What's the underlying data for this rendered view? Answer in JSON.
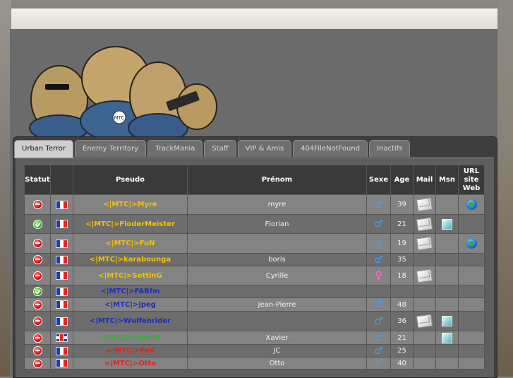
{
  "tabs": [
    {
      "label": "Urban Terror",
      "active": true
    },
    {
      "label": "Enemy Territory",
      "active": false
    },
    {
      "label": "TrackMania",
      "active": false
    },
    {
      "label": "Staff",
      "active": false
    },
    {
      "label": "VIP & Amis",
      "active": false
    },
    {
      "label": "404FileNotFound",
      "active": false
    },
    {
      "label": "Inactifs",
      "active": false
    }
  ],
  "table": {
    "headers": {
      "statut": "Statut",
      "pseudo": "Pseudo",
      "prenom": "Prénom",
      "sexe": "Sexe",
      "age": "Age",
      "mail": "Mail",
      "msn": "Msn",
      "url": "URL site Web"
    },
    "rows": [
      {
        "status": "offline",
        "flag": "fr",
        "pseudo": "<|MTC|>Myre",
        "color": "yellow",
        "prenom": "myre",
        "sexe": "male",
        "age": "39",
        "mail": true,
        "msn": false,
        "web": true
      },
      {
        "status": "online",
        "flag": "fr",
        "pseudo": "<|MTC|>FloderMeister",
        "color": "yellow",
        "prenom": "Florian",
        "sexe": "male",
        "age": "21",
        "mail": true,
        "msn": true,
        "web": false
      },
      {
        "status": "offline",
        "flag": "fr",
        "pseudo": "<|MTC|>FuN",
        "color": "yellow",
        "prenom": "",
        "sexe": "male",
        "age": "19",
        "mail": true,
        "msn": false,
        "web": true
      },
      {
        "status": "offline",
        "flag": "fr",
        "pseudo": "<|MTC|>karabounga",
        "color": "yellow",
        "prenom": "boris",
        "sexe": "male",
        "age": "35",
        "mail": false,
        "msn": false,
        "web": false
      },
      {
        "status": "offline",
        "flag": "fr",
        "pseudo": "<|MTC|>SettinG",
        "color": "yellow",
        "prenom": "Cyrille",
        "sexe": "female",
        "age": "18",
        "mail": true,
        "msn": false,
        "web": false
      },
      {
        "status": "online",
        "flag": "fr",
        "pseudo": "<|MTC|>FABfm",
        "color": "blue",
        "prenom": "",
        "sexe": "",
        "age": "",
        "mail": false,
        "msn": false,
        "web": false
      },
      {
        "status": "offline",
        "flag": "fr",
        "pseudo": "<|MTC|>jpeg",
        "color": "blue",
        "prenom": "Jean-Pierre",
        "sexe": "male",
        "age": "48",
        "mail": false,
        "msn": false,
        "web": false
      },
      {
        "status": "offline",
        "flag": "fr",
        "pseudo": "<|MTC|>Wulfenrider",
        "color": "blue",
        "prenom": "",
        "sexe": "male",
        "age": "36",
        "mail": true,
        "msn": true,
        "web": false
      },
      {
        "status": "offline",
        "flag": "uk",
        "pseudo": "<|MTC|>tryo24",
        "color": "green",
        "prenom": "Xavier",
        "sexe": "male",
        "age": "21",
        "mail": false,
        "msn": true,
        "web": false
      },
      {
        "status": "offline",
        "flag": "fr",
        "pseudo": "<|MTC|>Evil",
        "color": "red",
        "prenom": "JC",
        "sexe": "male",
        "age": "25",
        "mail": false,
        "msn": false,
        "web": false
      },
      {
        "status": "offline",
        "flag": "fr",
        "pseudo": "<|MTC|>Otto",
        "color": "red",
        "prenom": "Otto",
        "sexe": "male",
        "age": "40",
        "mail": false,
        "msn": false,
        "web": false
      }
    ]
  },
  "banner": {
    "badge_text": "MTC"
  }
}
